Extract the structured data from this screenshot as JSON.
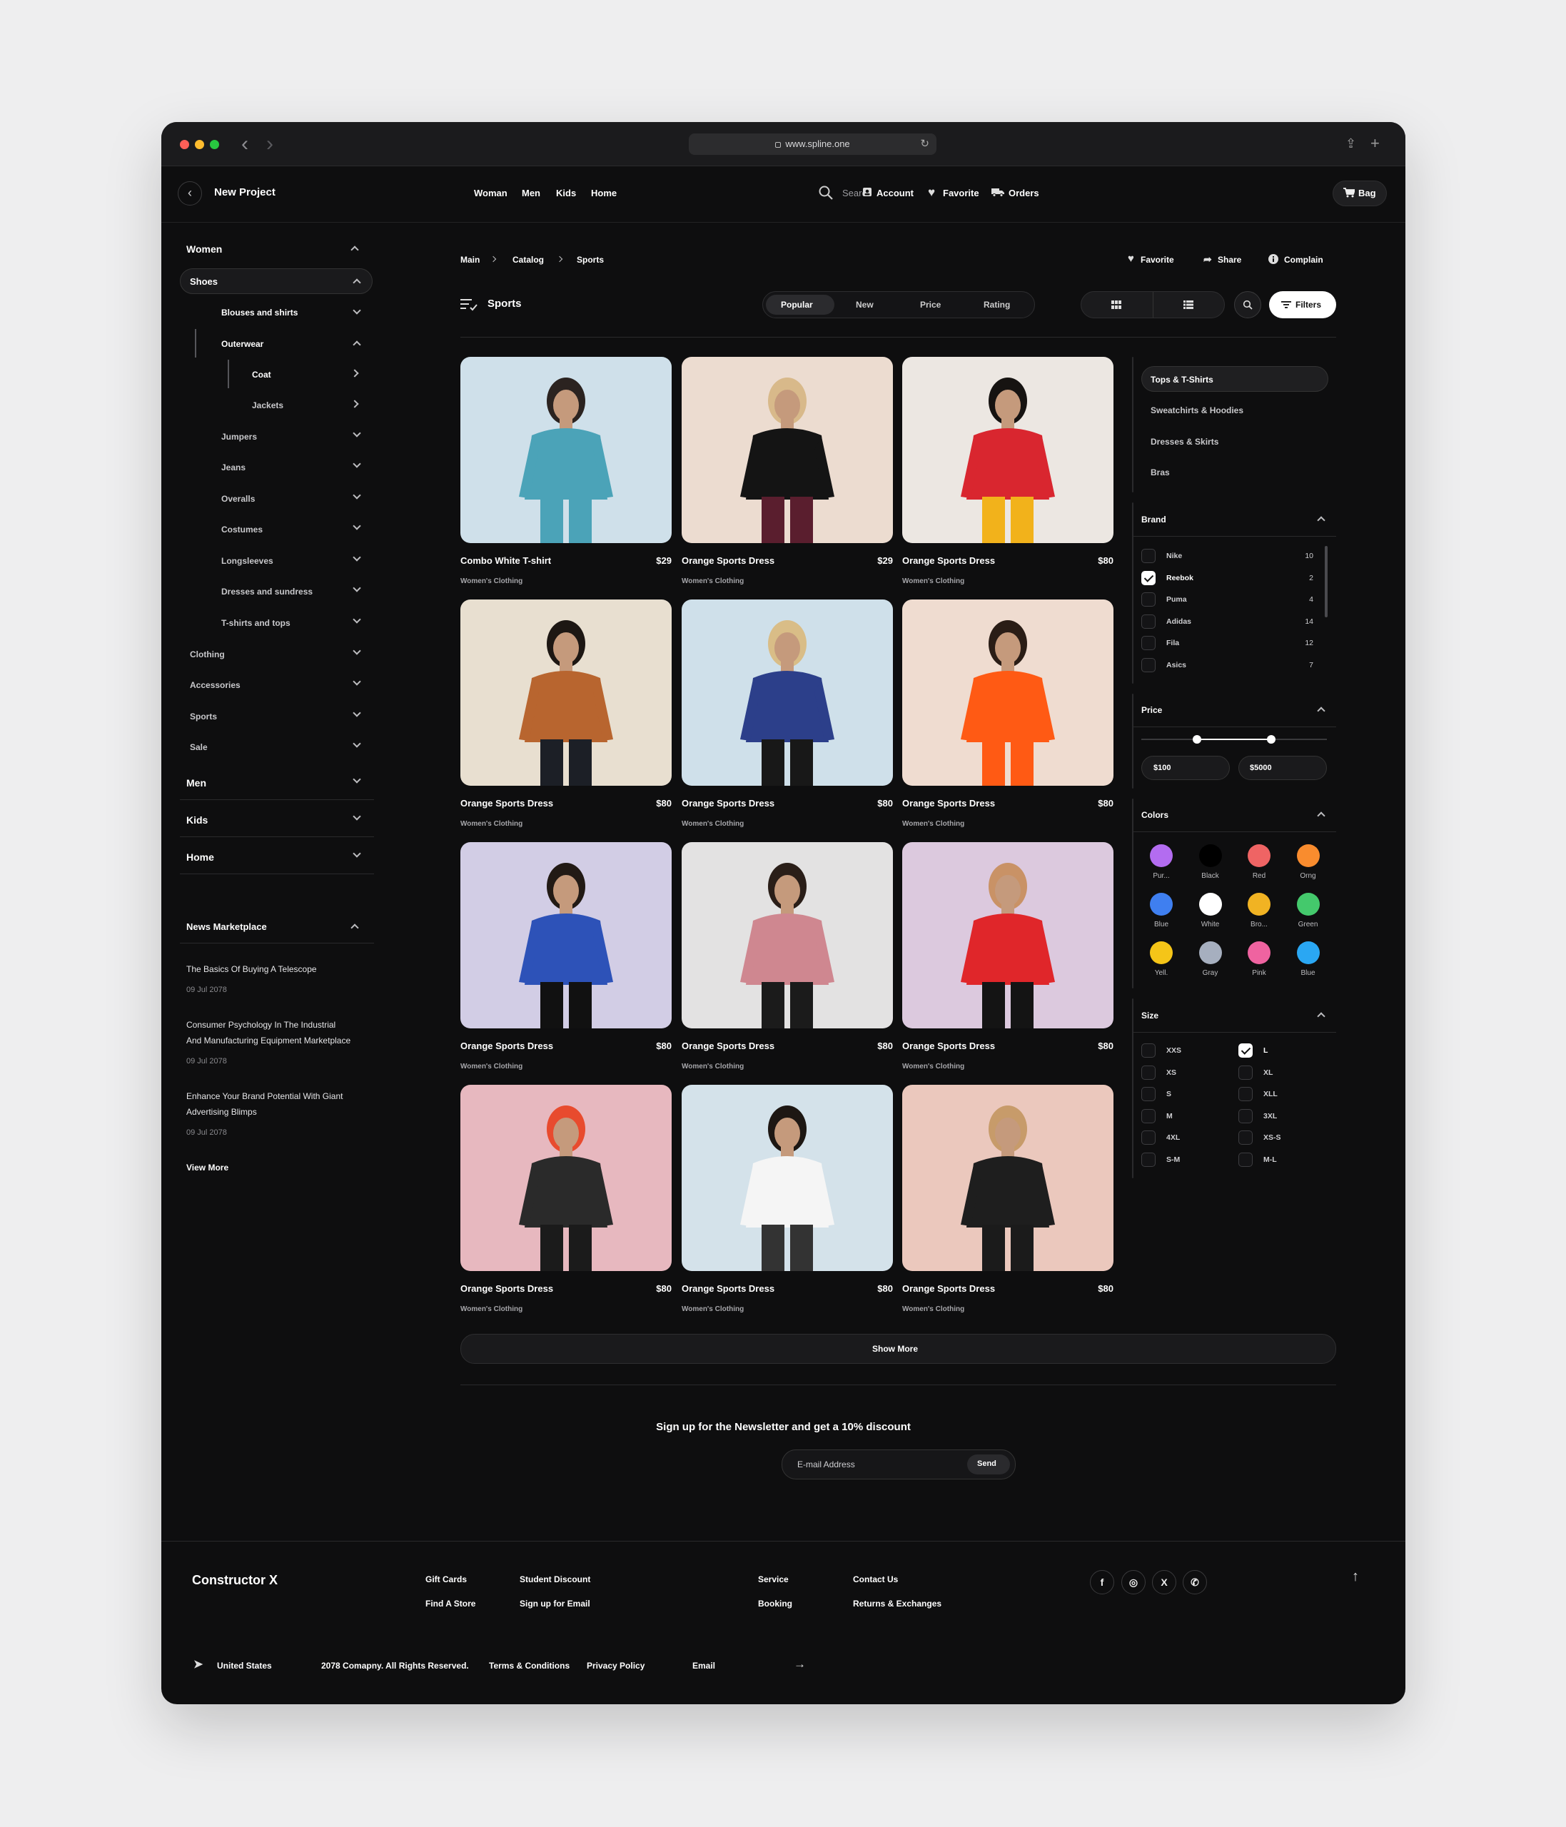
{
  "browser": {
    "url": "www.spline.one"
  },
  "header": {
    "back_label": "New Project",
    "nav": [
      "Woman",
      "Men",
      "Kids",
      "Home"
    ],
    "search_placeholder": "Search",
    "account": "Account",
    "favorite": "Favorite",
    "orders": "Orders",
    "bag": "Bag"
  },
  "sidebar": {
    "women": "Women",
    "shoes": "Shoes",
    "sub": [
      "Blouses and shirts",
      "Outerwear",
      "Coat",
      "Jackets",
      "Jumpers",
      "Jeans",
      "Overalls",
      "Costumes",
      "Longsleeves",
      "Dresses and sundress",
      "T-shirts and tops"
    ],
    "cats": [
      "Clothing",
      "Accessories",
      "Sports",
      "Sale"
    ],
    "men": "Men",
    "kids": "Kids",
    "home": "Home",
    "news_title": "News Marketplace",
    "news": [
      {
        "l1": "The Basics Of Buying A Telescope",
        "l2": "",
        "date": "09 Jul 2078"
      },
      {
        "l1": "Consumer Psychology In The Industrial",
        "l2": "And Manufacturing Equipment Marketplace",
        "date": "09 Jul 2078"
      },
      {
        "l1": "Enhance Your Brand Potential With Giant",
        "l2": "Advertising Blimps",
        "date": "09 Jul 2078"
      }
    ],
    "view_more": "View More"
  },
  "breadcrumb": [
    "Main",
    "Catalog",
    "Sports"
  ],
  "actions": {
    "favorite": "Favorite",
    "share": "Share",
    "complain": "Complain"
  },
  "page_title": "Sports",
  "sort_tabs": [
    "Popular",
    "New",
    "Price",
    "Rating"
  ],
  "filters_label": "Filters",
  "products": [
    {
      "name": "Combo White T-shirt",
      "price": "$29",
      "cat": "Women's Clothing",
      "bg": "#cfe0ea",
      "cloth": "#4ba3b8",
      "hair": "#2b2320",
      "legs": "#4ba3b8"
    },
    {
      "name": "Orange Sports Dress",
      "price": "$29",
      "cat": "Women's Clothing",
      "bg": "#ecdcd0",
      "cloth": "#141414",
      "hair": "#d8b98a",
      "legs": "#5a1e2e"
    },
    {
      "name": "Orange Sports Dress",
      "price": "$80",
      "cat": "Women's Clothing",
      "bg": "#ece7e2",
      "cloth": "#d9262f",
      "hair": "#161311",
      "legs": "#f2b21b"
    },
    {
      "name": "Orange Sports Dress",
      "price": "$80",
      "cat": "Women's Clothing",
      "bg": "#e8dfd0",
      "cloth": "#b8652f",
      "hair": "#1d1713",
      "legs": "#1c1f26"
    },
    {
      "name": "Orange Sports Dress",
      "price": "$80",
      "cat": "Women's Clothing",
      "bg": "#cfe0ea",
      "cloth": "#2c3f8a",
      "hair": "#d9bd87",
      "legs": "#181818"
    },
    {
      "name": "Orange Sports Dress",
      "price": "$80",
      "cat": "Women's Clothing",
      "bg": "#efdcd0",
      "cloth": "#ff5a14",
      "hair": "#2a1d16",
      "legs": "#ff5a14"
    },
    {
      "name": "Orange Sports Dress",
      "price": "$80",
      "cat": "Women's Clothing",
      "bg": "#d2cde5",
      "cloth": "#2d52b8",
      "hair": "#221a15",
      "legs": "#111"
    },
    {
      "name": "Orange Sports Dress",
      "price": "$80",
      "cat": "Women's Clothing",
      "bg": "#e3e2e2",
      "cloth": "#cf8790",
      "hair": "#2a1e18",
      "legs": "#1b1b1b"
    },
    {
      "name": "Orange Sports Dress",
      "price": "$80",
      "cat": "Women's Clothing",
      "bg": "#dcc9de",
      "cloth": "#e0262a",
      "hair": "#c99266",
      "legs": "#141414"
    },
    {
      "name": "Orange Sports Dress",
      "price": "$80",
      "cat": "Women's Clothing",
      "bg": "#e7b8bf",
      "cloth": "#2a2a2a",
      "hair": "#e84b2e",
      "legs": "#1b1b1b"
    },
    {
      "name": "Orange Sports Dress",
      "price": "$80",
      "cat": "Women's Clothing",
      "bg": "#d4e2ea",
      "cloth": "#f5f5f5",
      "hair": "#1d1713",
      "legs": "#333"
    },
    {
      "name": "Orange Sports Dress",
      "price": "$80",
      "cat": "Women's Clothing",
      "bg": "#ebc8bd",
      "cloth": "#1e1e1e",
      "hair": "#c79b6a",
      "legs": "#1b1b1b"
    }
  ],
  "show_more": "Show More",
  "categories": [
    "Tops & T-Shirts",
    "Sweatchirts & Hoodies",
    "Dresses & Skirts",
    "Bras"
  ],
  "brand": {
    "title": "Brand",
    "items": [
      {
        "name": "Nike",
        "count": "10",
        "checked": false
      },
      {
        "name": "Reebok",
        "count": "2",
        "checked": true
      },
      {
        "name": "Puma",
        "count": "4",
        "checked": false
      },
      {
        "name": "Adidas",
        "count": "14",
        "checked": false
      },
      {
        "name": "Fila",
        "count": "12",
        "checked": false
      },
      {
        "name": "Asics",
        "count": "7",
        "checked": false
      }
    ]
  },
  "price": {
    "title": "Price",
    "min": "$100",
    "max": "$5000",
    "range_low": 0.3,
    "range_high": 0.7
  },
  "colors": {
    "title": "Colors",
    "items": [
      {
        "name": "Pur...",
        "hex": "#b36cf0"
      },
      {
        "name": "Black",
        "hex": "#000000"
      },
      {
        "name": "Red",
        "hex": "#ef6464"
      },
      {
        "name": "Orng",
        "hex": "#f98c2e"
      },
      {
        "name": "Blue",
        "hex": "#3f7ff0"
      },
      {
        "name": "White",
        "hex": "#ffffff"
      },
      {
        "name": "Bro...",
        "hex": "#f1b323"
      },
      {
        "name": "Green",
        "hex": "#44c96c"
      },
      {
        "name": "Yell.",
        "hex": "#f5c518"
      },
      {
        "name": "Gray",
        "hex": "#a6afbf"
      },
      {
        "name": "Pink",
        "hex": "#ef63a0"
      },
      {
        "name": "Blue",
        "hex": "#2aa7f3"
      }
    ]
  },
  "size": {
    "title": "Size",
    "left": [
      {
        "name": "XXS",
        "checked": false
      },
      {
        "name": "XS",
        "checked": false
      },
      {
        "name": "S",
        "checked": false
      },
      {
        "name": "M",
        "checked": false
      },
      {
        "name": "4XL",
        "checked": false
      },
      {
        "name": "S-M",
        "checked": false
      }
    ],
    "right": [
      {
        "name": "L",
        "checked": true
      },
      {
        "name": "XL",
        "checked": false
      },
      {
        "name": "XLL",
        "checked": false
      },
      {
        "name": "3XL",
        "checked": false
      },
      {
        "name": "XS-S",
        "checked": false
      },
      {
        "name": "M-L",
        "checked": false
      }
    ]
  },
  "newsletter": {
    "title": "Sign up for the Newsletter and get a 10% discount",
    "placeholder": "E-mail Address",
    "send": "Send"
  },
  "footer": {
    "brand": "Constructor X",
    "links1": [
      "Gift Cards",
      "Find A Store"
    ],
    "links2": [
      "Student Discount",
      "Sign up for Email"
    ],
    "links3": [
      "Service",
      "Booking"
    ],
    "links4": [
      "Contact Us",
      "Returns & Exchanges"
    ],
    "socials": [
      "f",
      "◎",
      "X",
      "✆"
    ],
    "country": "United States",
    "copyright": "2078 Comapny. All Rights Reserved.",
    "terms": "Terms & Conditions",
    "privacy": "Privacy Policy",
    "email": "Email"
  }
}
